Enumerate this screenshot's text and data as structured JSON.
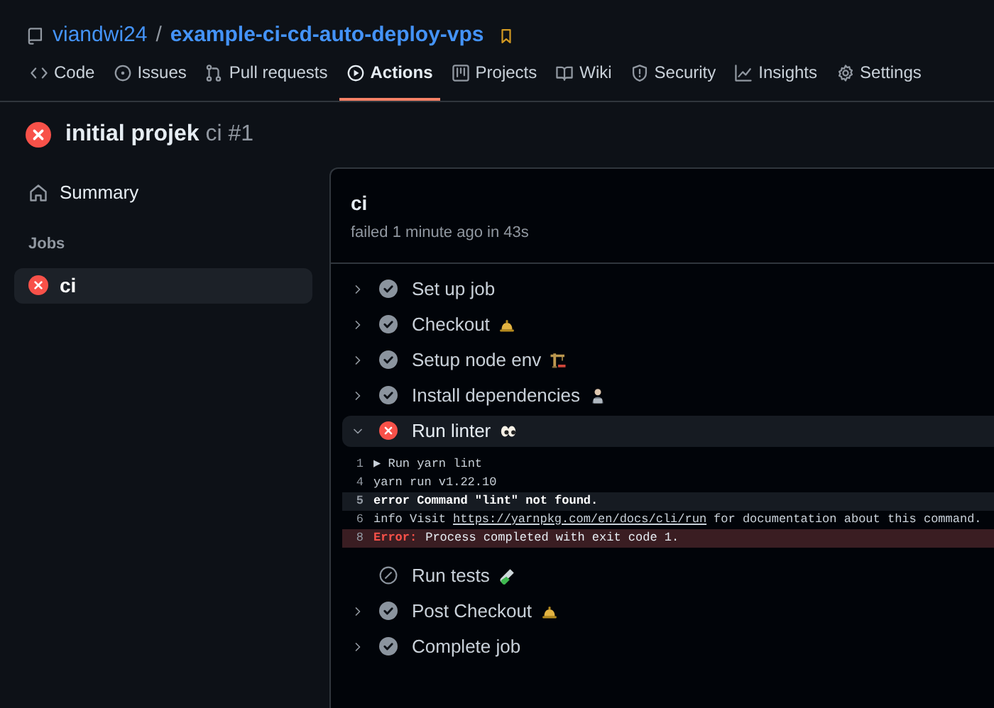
{
  "repo": {
    "owner": "viandwi24",
    "separator": "/",
    "name": "example-ci-cd-auto-deploy-vps"
  },
  "tabs": [
    {
      "label": "Code",
      "selected": false
    },
    {
      "label": "Issues",
      "selected": false
    },
    {
      "label": "Pull requests",
      "selected": false
    },
    {
      "label": "Actions",
      "selected": true
    },
    {
      "label": "Projects",
      "selected": false
    },
    {
      "label": "Wiki",
      "selected": false
    },
    {
      "label": "Security",
      "selected": false
    },
    {
      "label": "Insights",
      "selected": false
    },
    {
      "label": "Settings",
      "selected": false
    }
  ],
  "run": {
    "kind": "failure",
    "title": "initial projek",
    "workflow": "ci #1"
  },
  "sidebar": {
    "summary": "Summary",
    "jobs_heading": "Jobs",
    "jobs": [
      {
        "name": "ci",
        "kind": "failure",
        "selected": true
      }
    ]
  },
  "job": {
    "name": "ci",
    "meta": "failed 1 minute ago in 43s"
  },
  "steps": [
    {
      "name": "Set up job",
      "kind": "success",
      "expanded": false
    },
    {
      "name": "Checkout",
      "kind": "success",
      "expanded": false
    },
    {
      "name": "Setup node env",
      "kind": "success",
      "expanded": false
    },
    {
      "name": "Install dependencies",
      "kind": "success",
      "expanded": false
    },
    {
      "name": "Run linter",
      "kind": "failure",
      "expanded": true,
      "log": [
        {
          "kind": "plain",
          "number": "1",
          "text": "▶ Run yarn lint"
        },
        {
          "kind": "plain",
          "number": "4",
          "text": "yarn run v1.22.10"
        },
        {
          "kind": "highlight",
          "number": "5",
          "text": "error Command \"lint\" not found."
        },
        {
          "kind": "link",
          "number": "6",
          "text": "info Visit",
          "link": "https://yarnpkg.com/en/docs/cli/run",
          "after": "for documentation about this command."
        },
        {
          "kind": "error",
          "number": "8",
          "label": "Error:",
          "text": "Process completed with exit code 1."
        }
      ]
    },
    {
      "name": "Run tests",
      "kind": "skipped",
      "expanded": false
    },
    {
      "name": "Post Checkout",
      "kind": "success",
      "expanded": false
    },
    {
      "name": "Complete job",
      "kind": "success",
      "expanded": false
    }
  ]
}
